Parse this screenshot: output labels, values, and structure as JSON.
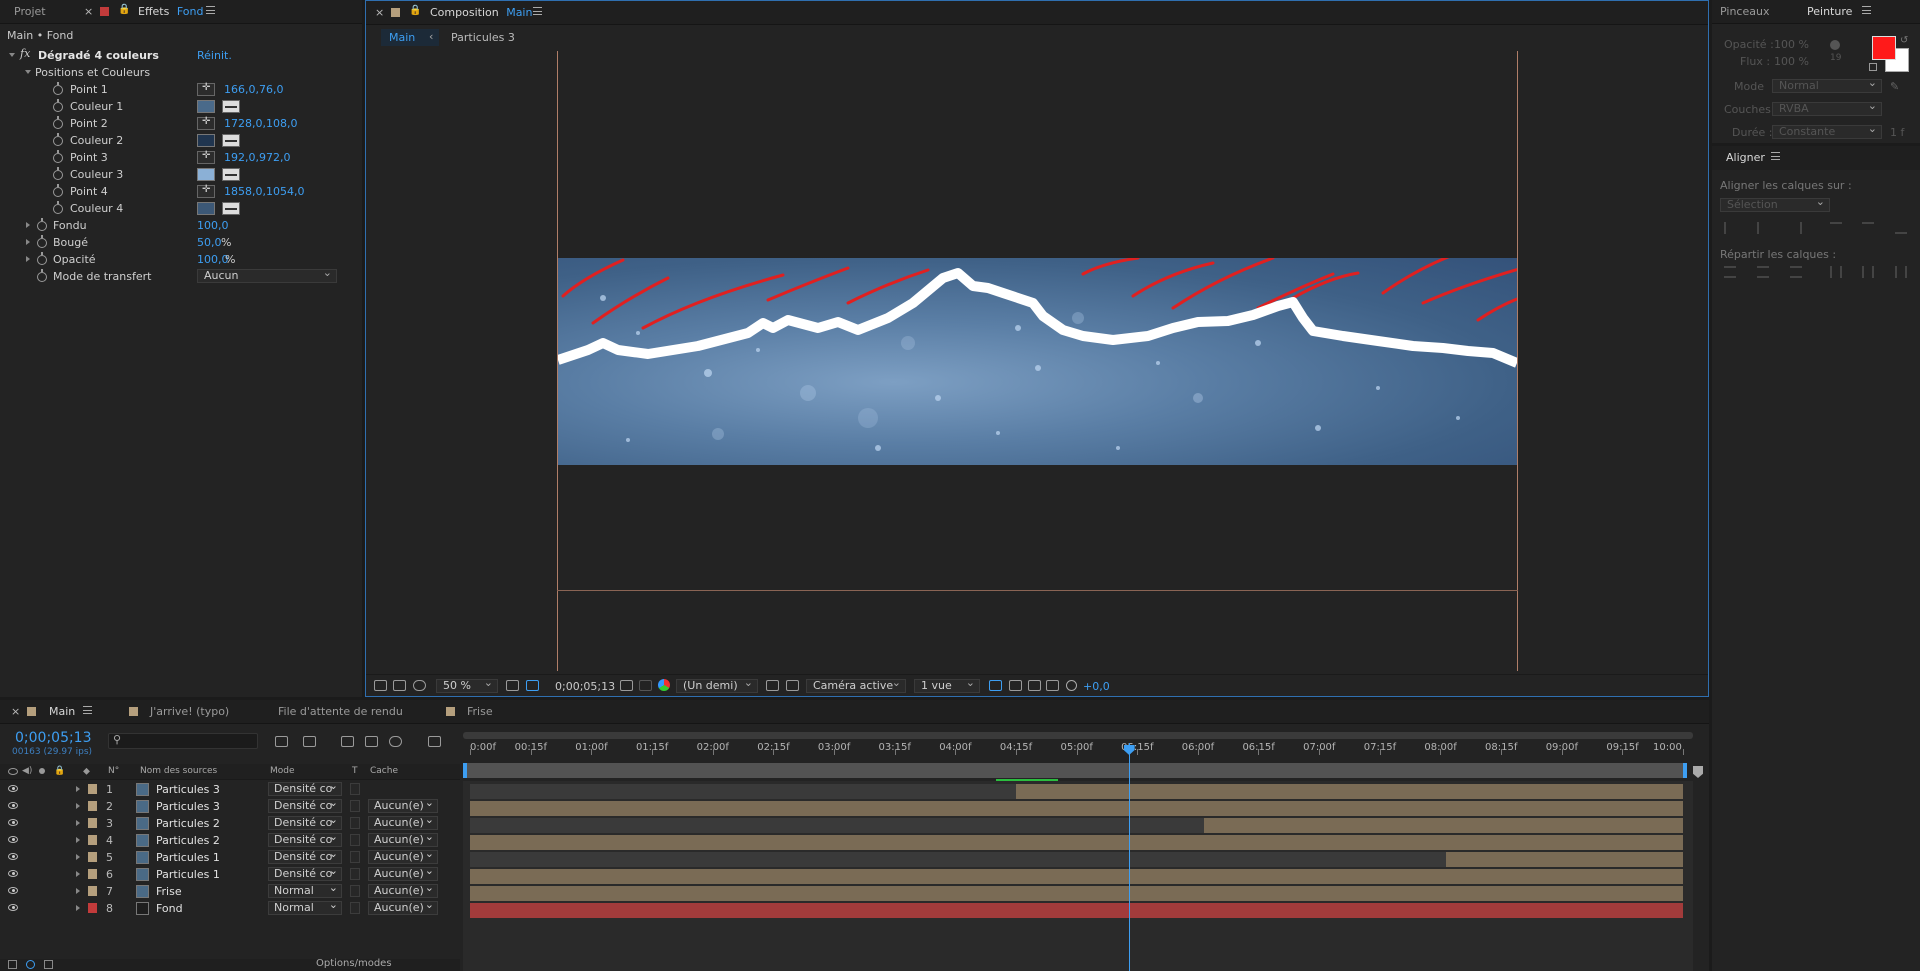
{
  "effects_panel": {
    "tabs": [
      "Projet",
      "Effets",
      "Fond"
    ],
    "breadcrumb": "Main • Fond",
    "effect_name": "Dégradé 4 couleurs",
    "reset_label": "Réinit.",
    "group_label": "Positions et Couleurs",
    "fx_label": "fx",
    "properties": [
      {
        "name": "Point 1",
        "value": "166,0,76,0"
      },
      {
        "name": "Couleur 1",
        "color": "#4a6a8a"
      },
      {
        "name": "Point 2",
        "value": "1728,0,108,0"
      },
      {
        "name": "Couleur 2",
        "color": "#20354f"
      },
      {
        "name": "Point 3",
        "value": "192,0,972,0"
      },
      {
        "name": "Couleur 3",
        "color": "#8bb0d6"
      },
      {
        "name": "Point 4",
        "value": "1858,0,1054,0"
      },
      {
        "name": "Couleur 4",
        "color": "#3c5876"
      }
    ],
    "fondu": {
      "name": "Fondu",
      "value": "100,0"
    },
    "bouge": {
      "name": "Bougé",
      "value": "50,0",
      "unit": "%"
    },
    "opacite": {
      "name": "Opacité",
      "value": "100,0",
      "unit": "%"
    },
    "transfer": {
      "name": "Mode de transfert",
      "value": "Aucun"
    }
  },
  "composition_panel": {
    "title_prefix": "Composition",
    "title_name": "Main",
    "breadcrumb_main": "Main",
    "breadcrumb_child": "Particules 3",
    "footer": {
      "zoom": "50 %",
      "timecode": "0;00;05;13",
      "resolution": "(Un demi)",
      "camera": "Caméra active",
      "views": "1 vue",
      "exposure": "+0,0"
    }
  },
  "right_panels": {
    "tabs": [
      "Pinceaux",
      "Peinture"
    ],
    "opacity_label": "Opacité :",
    "opacity_value": "100 %",
    "flux_label": "Flux :",
    "flux_value": "100 %",
    "brush_size": "19",
    "mode_label": "Mode",
    "mode_value": "Normal",
    "channels_label": "Couches :",
    "channels_value": "RVBA",
    "duration_label": "Durée :",
    "duration_value": "Constante",
    "duration_frame": "1 f",
    "foreground_color": "#ff1a1a",
    "background_color": "#ffffff",
    "align_title": "Aligner",
    "align_to_label": "Aligner les calques sur :",
    "align_to_value": "Sélection",
    "distribute_label": "Répartir les calques :"
  },
  "timeline": {
    "tabs": [
      "Main",
      "J'arrive! (typo)",
      "File d'attente de rendu",
      "Frise"
    ],
    "current_time": "0;00;05;13",
    "frame_info": "00163 (29.97 ips)",
    "columns": {
      "num": "N°",
      "source": "Nom des sources",
      "mode": "Mode",
      "t": "T",
      "cache": "Cache"
    },
    "layers": [
      {
        "num": "1",
        "name": "Particules 3",
        "mode": "Densité co",
        "cache": "",
        "color": "#b59f7d"
      },
      {
        "num": "2",
        "name": "Particules 3",
        "mode": "Densité co",
        "cache": "Aucun(e)",
        "color": "#b59f7d"
      },
      {
        "num": "3",
        "name": "Particules 2",
        "mode": "Densité co",
        "cache": "Aucun(e)",
        "color": "#b59f7d"
      },
      {
        "num": "4",
        "name": "Particules 2",
        "mode": "Densité co",
        "cache": "Aucun(e)",
        "color": "#b59f7d"
      },
      {
        "num": "5",
        "name": "Particules 1",
        "mode": "Densité co",
        "cache": "Aucun(e)",
        "color": "#b59f7d"
      },
      {
        "num": "6",
        "name": "Particules 1",
        "mode": "Densité co",
        "cache": "Aucun(e)",
        "color": "#b59f7d"
      },
      {
        "num": "7",
        "name": "Frise",
        "mode": "Normal",
        "cache": "Aucun(e)",
        "color": "#b59f7d"
      },
      {
        "num": "8",
        "name": "Fond",
        "mode": "Normal",
        "cache": "Aucun(e)",
        "color": "#c23b3b"
      }
    ],
    "ruler_ticks": [
      "0:00f",
      "00:15f",
      "01:00f",
      "01:15f",
      "02:00f",
      "02:15f",
      "03:00f",
      "03:15f",
      "04:00f",
      "04:15f",
      "05:00f",
      "05:15f",
      "06:00f",
      "06:15f",
      "07:00f",
      "07:15f",
      "08:00f",
      "08:15f",
      "09:00f",
      "09:15f",
      "10:00"
    ],
    "duration_seconds": 10,
    "playhead_seconds": 5.43,
    "bars": [
      {
        "start": 4.5,
        "end": 10,
        "dark_until": 4.5
      },
      {
        "start": 0,
        "end": 10,
        "dark_until": 0
      },
      {
        "start": 0,
        "end": 10,
        "dark_until": 6.05
      },
      {
        "start": 0,
        "end": 10,
        "dark_until": 0
      },
      {
        "start": 0,
        "end": 10,
        "dark_until": 8.05
      },
      {
        "start": 0,
        "end": 10,
        "dark_until": 0
      },
      {
        "start": 0,
        "end": 10,
        "dark_until": 0
      },
      {
        "start": 0,
        "end": 10,
        "dark_until": 0
      }
    ],
    "footer_label": "Options/modes"
  }
}
